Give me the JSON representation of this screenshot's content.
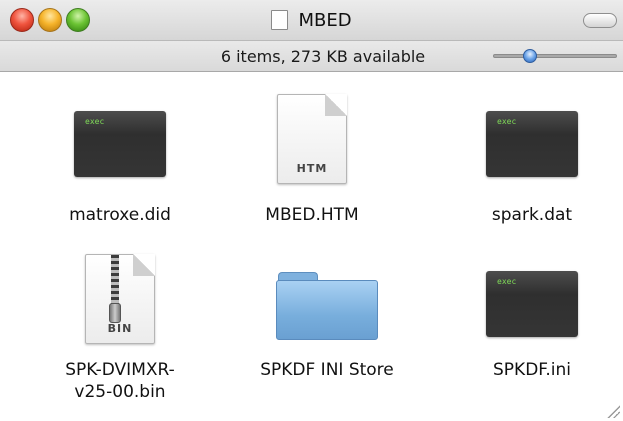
{
  "window": {
    "title": "MBED",
    "status": "6 items, 273 KB available",
    "icon_size_slider": 0.3
  },
  "items": [
    {
      "name": "matroxe.did",
      "icon": "exec-icon",
      "badge": "exec"
    },
    {
      "name": "MBED.HTM",
      "icon": "htm-document-icon",
      "badge": "HTM"
    },
    {
      "name": "spark.dat",
      "icon": "exec-icon",
      "badge": "exec"
    },
    {
      "name": "SPK-DVIMXR-\nv25-00.bin",
      "icon": "bin-archive-icon",
      "badge": "BIN"
    },
    {
      "name": "SPKDF INI Store",
      "icon": "folder-icon"
    },
    {
      "name": "SPKDF.ini",
      "icon": "exec-icon",
      "badge": "exec"
    }
  ],
  "colors": {
    "close": "#f0553f",
    "minimize": "#f6b42b",
    "zoom": "#6cc434",
    "folder": "#78aedc",
    "exec_text": "#7ed957"
  }
}
